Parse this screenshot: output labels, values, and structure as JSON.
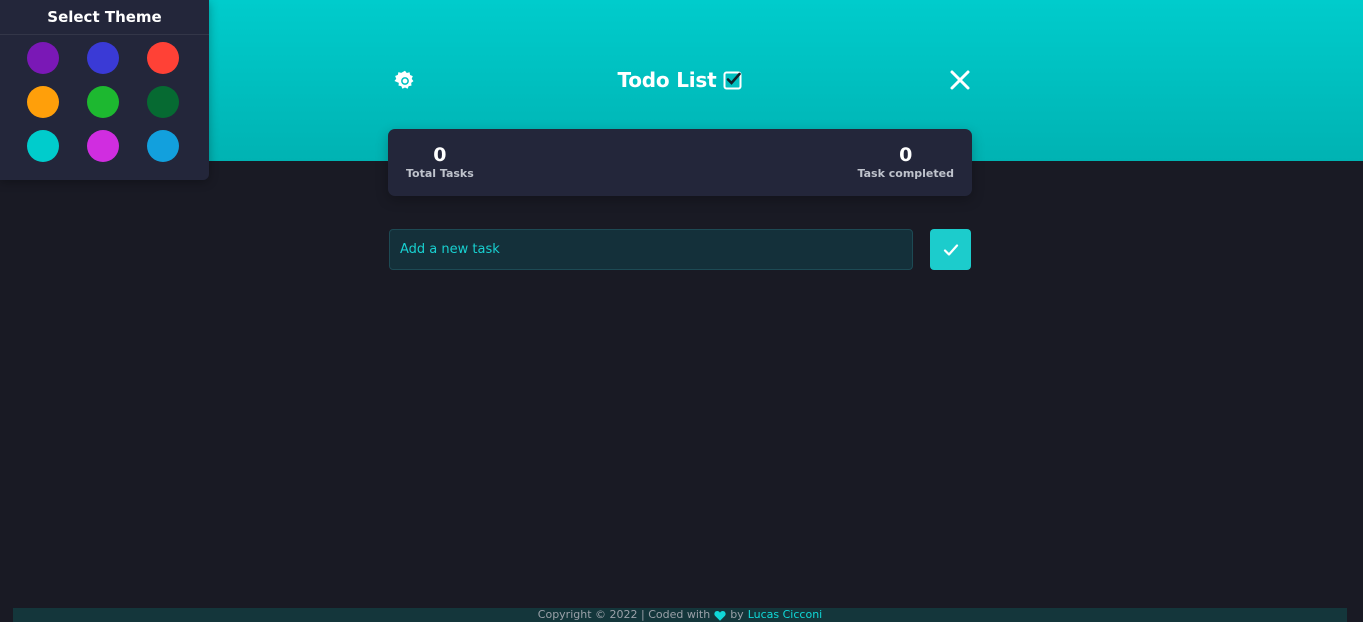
{
  "colors": {
    "accent": "#00cccc",
    "background": "#191a24",
    "card": "#23263a"
  },
  "header": {
    "title": "Todo List",
    "title_icon": "checkbox-icon",
    "settings_icon": "gear-icon",
    "close_icon": "close-icon"
  },
  "stats": {
    "total": {
      "value": "0",
      "label": "Total Tasks"
    },
    "completed": {
      "value": "0",
      "label": "Task completed"
    }
  },
  "add_task": {
    "placeholder": "Add a new task",
    "value": "",
    "button_icon": "check-icon"
  },
  "theme_panel": {
    "title": "Select Theme",
    "swatches": [
      "#7a18b6",
      "#3a3ad6",
      "#ff4136",
      "#ff9f0a",
      "#1db830",
      "#066a32",
      "#00cccc",
      "#d02de0",
      "#12a0dd"
    ]
  },
  "footer": {
    "prefix": "Copyright © 2022 | Coded with",
    "heart_icon": "heart-icon",
    "by": "by",
    "author": "Lucas Cicconi"
  }
}
